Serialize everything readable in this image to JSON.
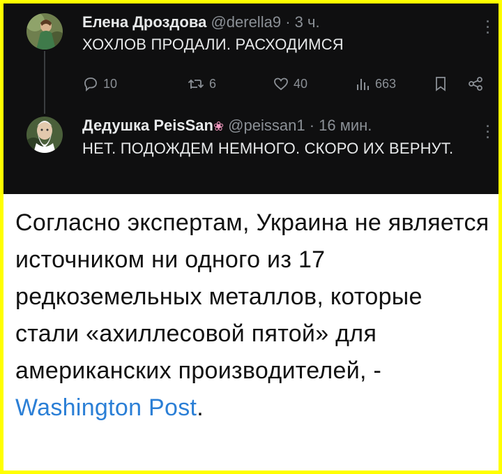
{
  "tweet1": {
    "name": "Елена Дроздова",
    "handle": "@derella9",
    "separator": "·",
    "time": "3 ч.",
    "text": "ХОХЛОВ ПРОДАЛИ. РАСХОДИМСЯ",
    "replies": "10",
    "retweets": "6",
    "likes": "40",
    "views": "663"
  },
  "tweet2": {
    "name": "Дедушка PeisSan",
    "name_emoji": "❀",
    "handle": "@peissan1",
    "separator": "·",
    "time": "16 мин.",
    "text": "НЕТ. ПОДОЖДЕМ НЕМНОГО. СКОРО ИХ ВЕРНУТ."
  },
  "caption": {
    "text": "Согласно экспертам, Украина не является источником ни одного из 17 редкоземельных металлов, которые стали «ахиллесовой пятой» для американских производителей, - ",
    "link": "Washington Post",
    "end": "."
  },
  "colors": {
    "frame_border": "#ffff00",
    "dark_bg": "#0f0f10",
    "text_light": "#e7e9ea",
    "text_muted": "#8b9096",
    "link": "#2b7fd6"
  },
  "icons": [
    "reply-icon",
    "retweet-icon",
    "like-icon",
    "views-icon",
    "bookmark-icon",
    "share-icon",
    "more-icon",
    "flower-emoji-icon"
  ]
}
